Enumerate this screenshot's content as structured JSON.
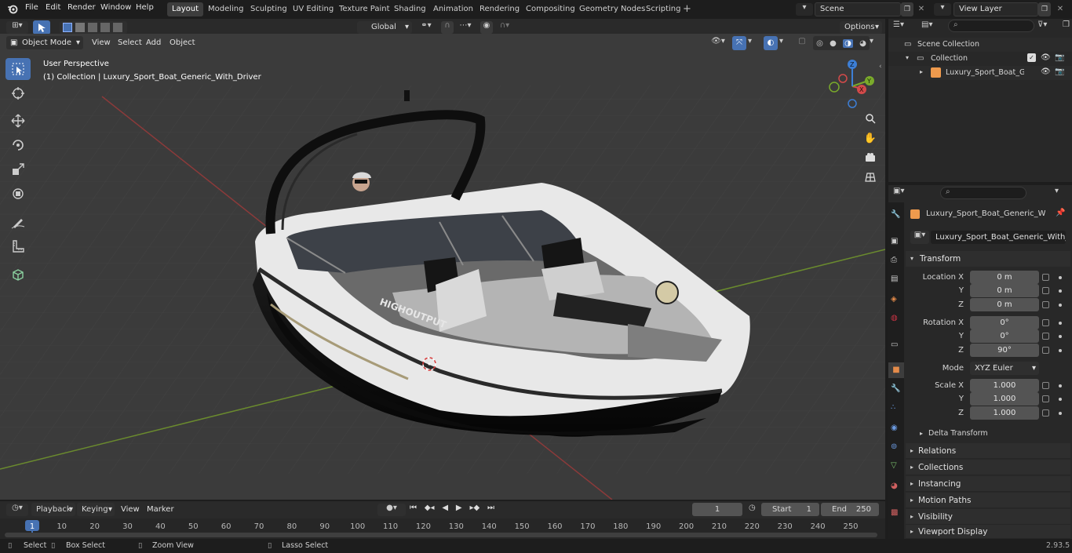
{
  "menu": {
    "file": "File",
    "edit": "Edit",
    "render": "Render",
    "window": "Window",
    "help": "Help"
  },
  "workspaces": [
    "Layout",
    "Modeling",
    "Sculpting",
    "UV Editing",
    "Texture Paint",
    "Shading",
    "Animation",
    "Rendering",
    "Compositing",
    "Geometry Nodes",
    "Scripting"
  ],
  "scene": "Scene",
  "view_layer": "View Layer",
  "header": {
    "orientation": "Global",
    "options": "Options"
  },
  "viewport_header": {
    "mode": "Object Mode",
    "view": "View",
    "select": "Select",
    "add": "Add",
    "object": "Object"
  },
  "viewport": {
    "perspective": "User Perspective",
    "collection_info": "(1) Collection | Luxury_Sport_Boat_Generic_With_Driver",
    "hull_text": "HIGHOUTPUT"
  },
  "gizmo": {
    "x": "X",
    "y": "Y",
    "z": "Z"
  },
  "outliner": {
    "scene_collection": "Scene Collection",
    "collection": "Collection",
    "object": "Luxury_Sport_Boat_Generic"
  },
  "properties": {
    "object_name": "Luxury_Sport_Boat_Generic_With_Dr...",
    "data_name": "Luxury_Sport_Boat_Generic_With_Driver",
    "transform": "Transform",
    "location_label": "Location X",
    "location": [
      "0 m",
      "0 m",
      "0 m"
    ],
    "rotation_label": "Rotation X",
    "rotation": [
      "0°",
      "0°",
      "90°"
    ],
    "mode_label": "Mode",
    "mode": "XYZ Euler",
    "scale_label": "Scale X",
    "scale": [
      "1.000",
      "1.000",
      "1.000"
    ],
    "axis_y": "Y",
    "axis_z": "Z",
    "delta": "Delta Transform",
    "panels": [
      "Relations",
      "Collections",
      "Instancing",
      "Motion Paths",
      "Visibility",
      "Viewport Display"
    ]
  },
  "timeline": {
    "playback": "Playback",
    "keying": "Keying",
    "view": "View",
    "marker": "Marker",
    "current_frame": "1",
    "start_label": "Start",
    "start": "1",
    "end_label": "End",
    "end": "250",
    "ticks": [
      "1",
      "10",
      "20",
      "30",
      "40",
      "50",
      "60",
      "70",
      "80",
      "90",
      "100",
      "110",
      "120",
      "130",
      "140",
      "150",
      "160",
      "170",
      "180",
      "190",
      "200",
      "210",
      "220",
      "230",
      "240",
      "250"
    ]
  },
  "status": {
    "select": "Select",
    "box_select": "Box Select",
    "zoom_view": "Zoom View",
    "lasso_select": "Lasso Select",
    "version": "2.93.5"
  }
}
